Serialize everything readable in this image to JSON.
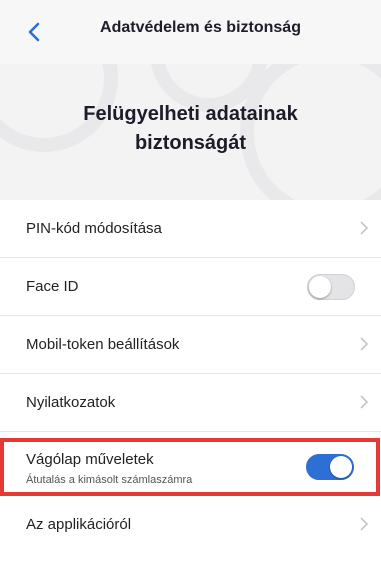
{
  "header": {
    "title": "Adatvédelem és biztonság",
    "back_icon": "chevron-left-icon"
  },
  "hero": {
    "title": "Felügyelheti adatainak biztonságát"
  },
  "colors": {
    "accent": "#2e6fd6",
    "highlight_border": "#e53935"
  },
  "settings": [
    {
      "label": "PIN-kód módosítása",
      "type": "link"
    },
    {
      "label": "Face ID",
      "type": "toggle",
      "enabled": false
    },
    {
      "label": "Mobil-token beállítások",
      "type": "link"
    },
    {
      "label": "Nyilatkozatok",
      "type": "link"
    },
    {
      "label": "Vágólap műveletek",
      "sublabel": "Átutalás a kimásolt számlaszámra",
      "type": "toggle",
      "enabled": true
    },
    {
      "label": "Az applikációról",
      "type": "link"
    }
  ]
}
